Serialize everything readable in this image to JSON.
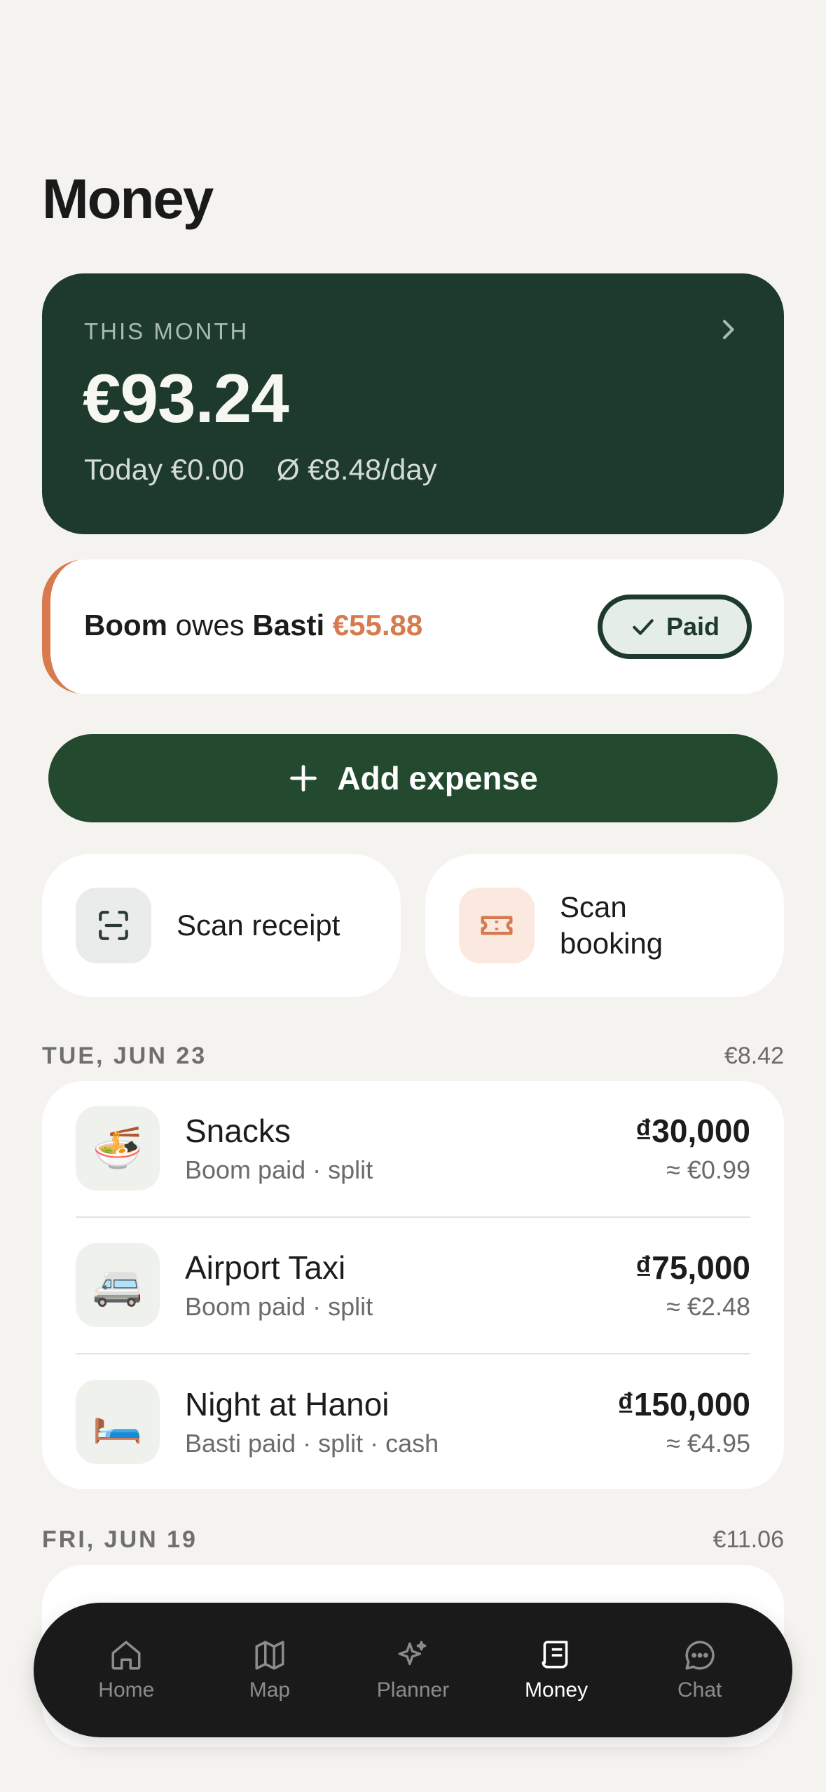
{
  "page": {
    "title": "Money"
  },
  "summary": {
    "label": "THIS MONTH",
    "amount": "€93.24",
    "today": "Today €0.00",
    "average": "Ø €8.48/day"
  },
  "debt": {
    "debtor": "Boom",
    "verb": "owes",
    "creditor": "Basti",
    "amount": "€55.88",
    "paid_label": "Paid"
  },
  "actions": {
    "add_expense": "Add expense",
    "scan_receipt": "Scan receipt",
    "scan_booking_line1": "Scan",
    "scan_booking_line2": "booking"
  },
  "days": [
    {
      "date": "TUE, JUN 23",
      "total": "€8.42",
      "items": [
        {
          "icon": "🍜",
          "title": "Snacks",
          "meta": "Boom paid · split",
          "amount": "₫30,000",
          "converted": "≈ €0.99"
        },
        {
          "icon": "🚐",
          "title": "Airport Taxi",
          "meta": "Boom paid · split",
          "amount": "₫75,000",
          "converted": "≈ €2.48"
        },
        {
          "icon": "🛏️",
          "title": "Night at Hanoi",
          "meta": "Basti paid · split · cash",
          "amount": "₫150,000",
          "converted": "≈ €4.95"
        }
      ]
    },
    {
      "date": "FRI, JUN 19",
      "total": "€11.06",
      "items": []
    }
  ],
  "tabs": [
    {
      "label": "Home",
      "icon": "home-icon"
    },
    {
      "label": "Map",
      "icon": "map-icon"
    },
    {
      "label": "Planner",
      "icon": "sparkles-icon"
    },
    {
      "label": "Money",
      "icon": "receipt-icon",
      "active": true
    },
    {
      "label": "Chat",
      "icon": "chat-icon"
    }
  ],
  "colors": {
    "background": "#f5f3ef",
    "card_dark": "#1e3a2d",
    "accent_orange": "#d77b4e",
    "button_green": "#23492f"
  }
}
